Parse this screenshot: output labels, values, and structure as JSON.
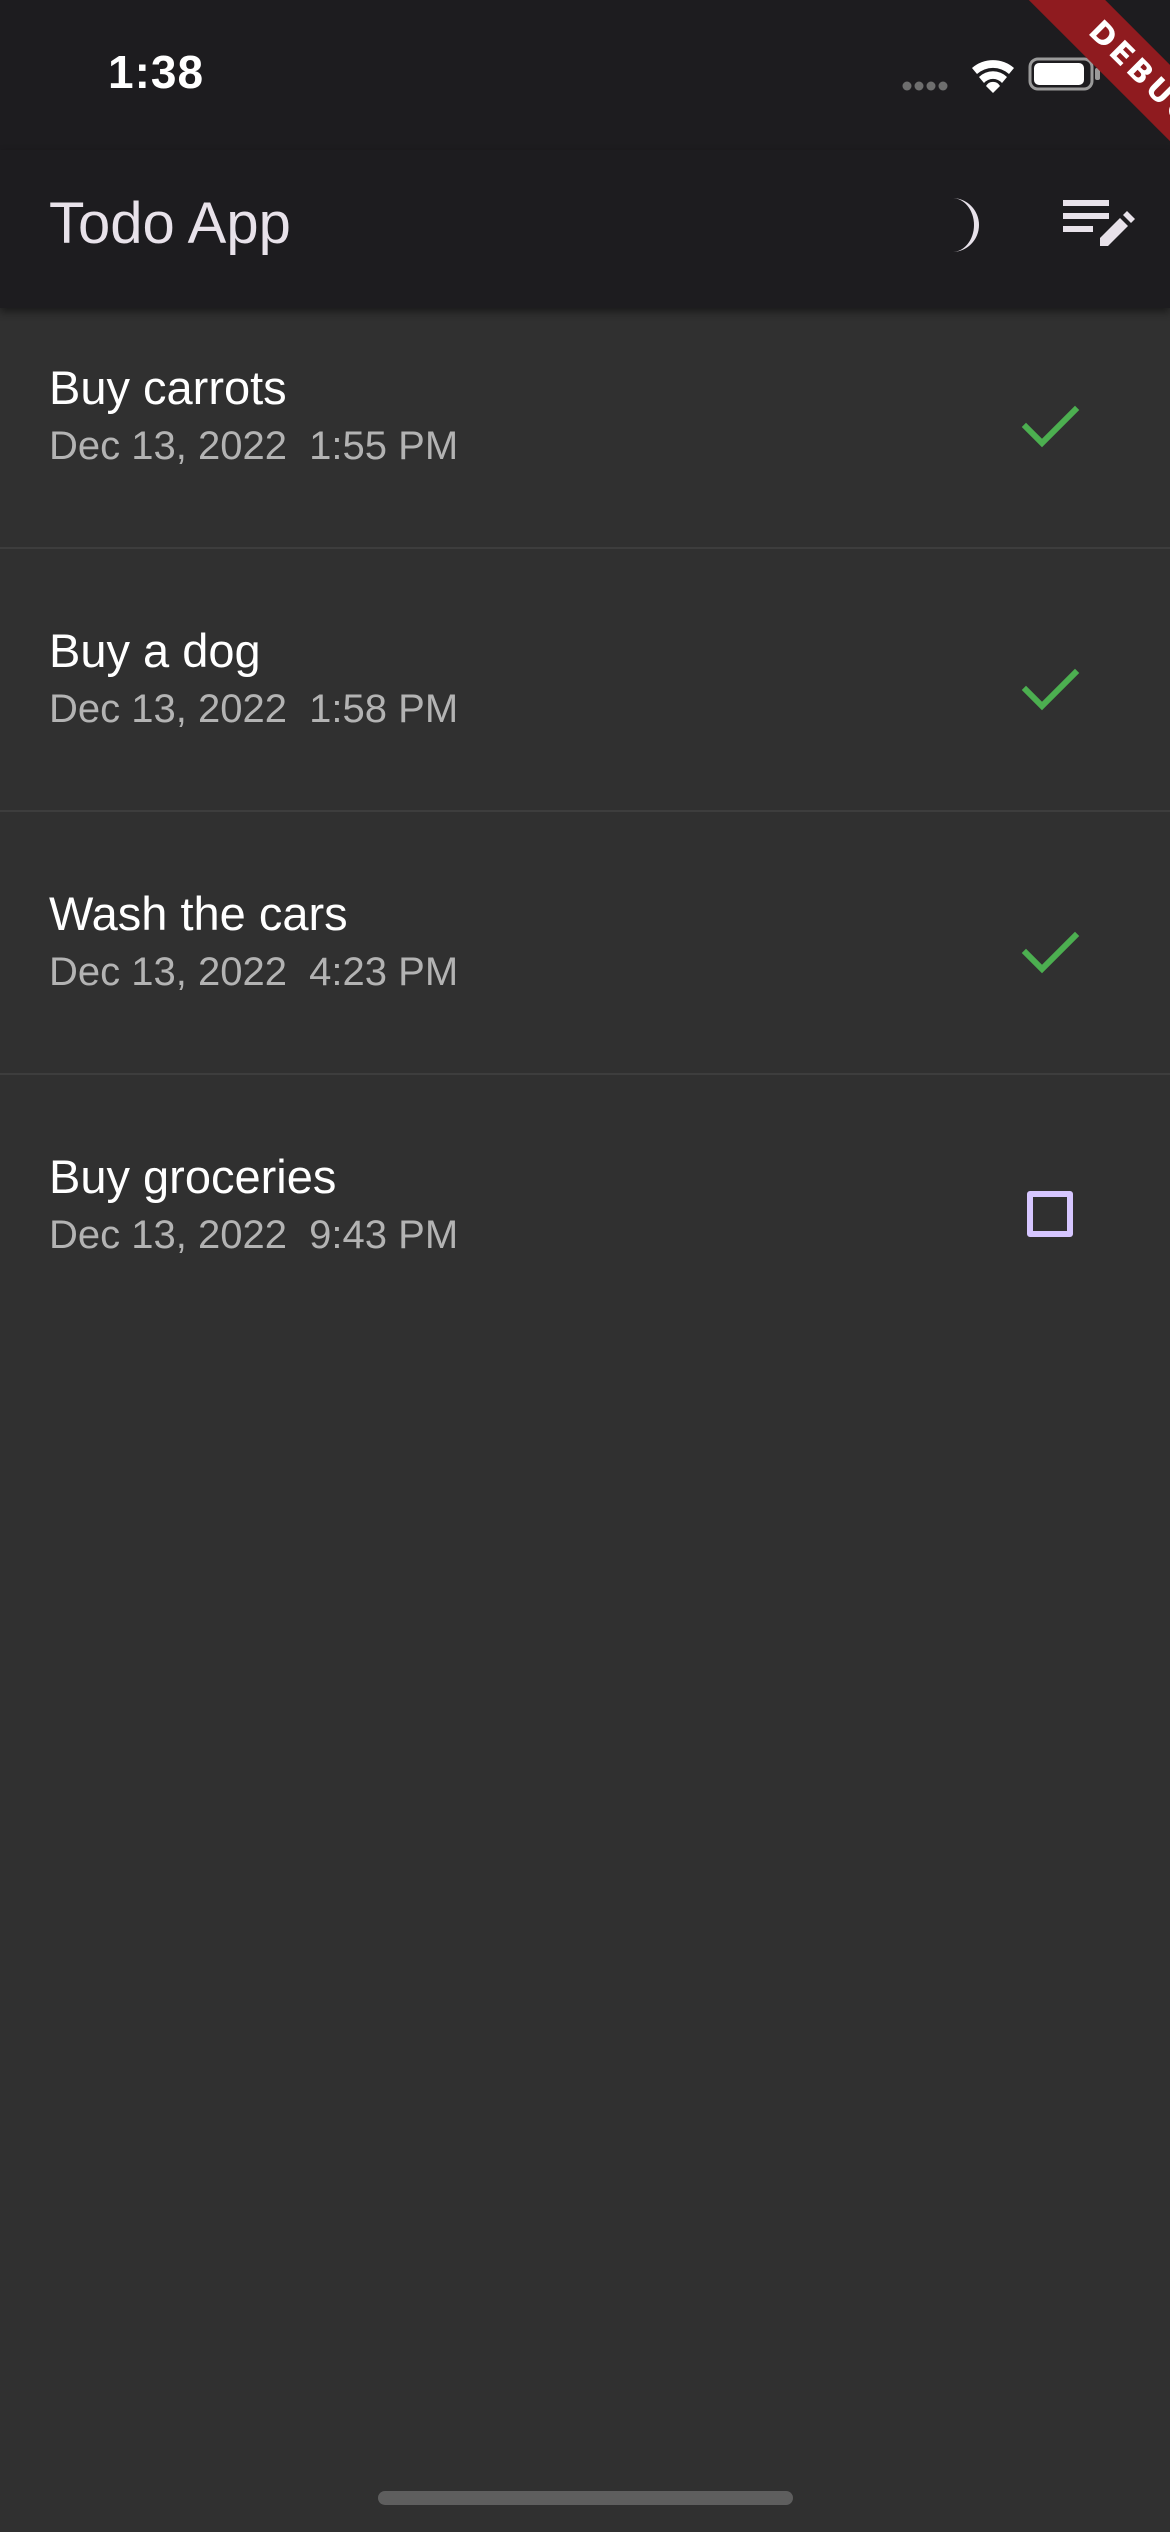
{
  "status_bar": {
    "time": "1:38",
    "icons": [
      "signal-dots-icon",
      "wifi-icon",
      "battery-icon"
    ]
  },
  "debug_banner": {
    "label": "DEBUG",
    "color": "#8f1b1f"
  },
  "app_bar": {
    "title": "Todo App",
    "actions": [
      {
        "icon": "moon-icon",
        "name": "theme-toggle-button"
      },
      {
        "icon": "edit-list-icon",
        "name": "edit-list-button"
      }
    ]
  },
  "todos": [
    {
      "title": "Buy carrots",
      "date": "Dec 13, 2022  1:55 PM",
      "completed": true
    },
    {
      "title": "Buy a dog",
      "date": "Dec 13, 2022  1:58 PM",
      "completed": true
    },
    {
      "title": "Wash the cars",
      "date": "Dec 13, 2022  4:23 PM",
      "completed": true
    },
    {
      "title": "Buy groceries",
      "date": "Dec 13, 2022  9:43 PM",
      "completed": false
    }
  ],
  "colors": {
    "background": "#303030",
    "app_bar": "#1d1c1f",
    "check_green": "#4caf50",
    "checkbox_outline": "#d6c6ff"
  }
}
